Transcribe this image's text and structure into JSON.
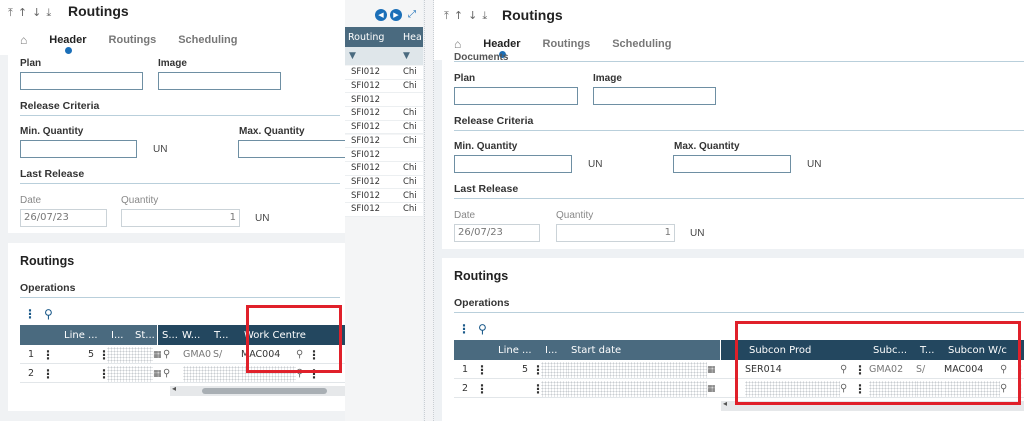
{
  "left": {
    "title": "Routings",
    "tabs": [
      "Header",
      "Routings",
      "Scheduling"
    ],
    "labels": {
      "plan": "Plan",
      "image": "Image",
      "release_criteria": "Release Criteria",
      "min_qty": "Min. Quantity",
      "max_qty": "Max. Quantity",
      "unit": "UN",
      "last_release": "Last Release",
      "date": "Date",
      "quantity": "Quantity"
    },
    "values": {
      "date": "26/07/23",
      "quantity": "1"
    },
    "routings_title": "Routings",
    "operations": "Operations",
    "grid": {
      "columns": [
        "Line ...",
        "I...",
        "St...",
        "S...",
        "W...",
        "T...",
        "Work Centre"
      ],
      "rows": [
        {
          "num": "1",
          "line": "5",
          "w": "GMA0",
          "t": "S/",
          "work_centre": "MAC004"
        },
        {
          "num": "2",
          "line": "",
          "w": "",
          "t": "",
          "work_centre": ""
        }
      ]
    }
  },
  "middle": {
    "columns": [
      "Routing",
      "Hea"
    ],
    "rows": [
      [
        "SFI012",
        "Chi"
      ],
      [
        "SFI012",
        "Chi"
      ],
      [
        "SFI012",
        ""
      ],
      [
        "SFI012",
        "Chi"
      ],
      [
        "SFI012",
        "Chi"
      ],
      [
        "SFI012",
        "Chi"
      ],
      [
        "SFI012",
        ""
      ],
      [
        "SFI012",
        "Chi"
      ],
      [
        "SFI012",
        "Chi"
      ],
      [
        "SFI012",
        "Chi"
      ],
      [
        "SFI012",
        "Chi"
      ]
    ]
  },
  "right": {
    "title": "Routings",
    "tabs": [
      "Header",
      "Routings",
      "Scheduling"
    ],
    "hidden_section": "Documents",
    "labels": {
      "plan": "Plan",
      "image": "Image",
      "release_criteria": "Release Criteria",
      "min_qty": "Min. Quantity",
      "max_qty": "Max. Quantity",
      "unit": "UN",
      "last_release": "Last Release",
      "date": "Date",
      "quantity": "Quantity"
    },
    "values": {
      "date": "26/07/23",
      "quantity": "1"
    },
    "routings_title": "Routings",
    "operations": "Operations",
    "grid": {
      "columns": [
        "Line ...",
        "I...",
        "Start date",
        "Subcon Prod",
        "Subc...",
        "T...",
        "Subcon W/c"
      ],
      "rows": [
        {
          "num": "1",
          "line": "5",
          "subcon_prod": "SER014",
          "subc": "GMA02",
          "t": "S/",
          "subcon_wc": "MAC004"
        },
        {
          "num": "2",
          "line": "",
          "subcon_prod": "",
          "subc": "",
          "t": "",
          "subcon_wc": ""
        }
      ]
    }
  },
  "colors": {
    "highlight": "#e0202a",
    "header": "#23475f",
    "accent": "#1b6fb8"
  }
}
